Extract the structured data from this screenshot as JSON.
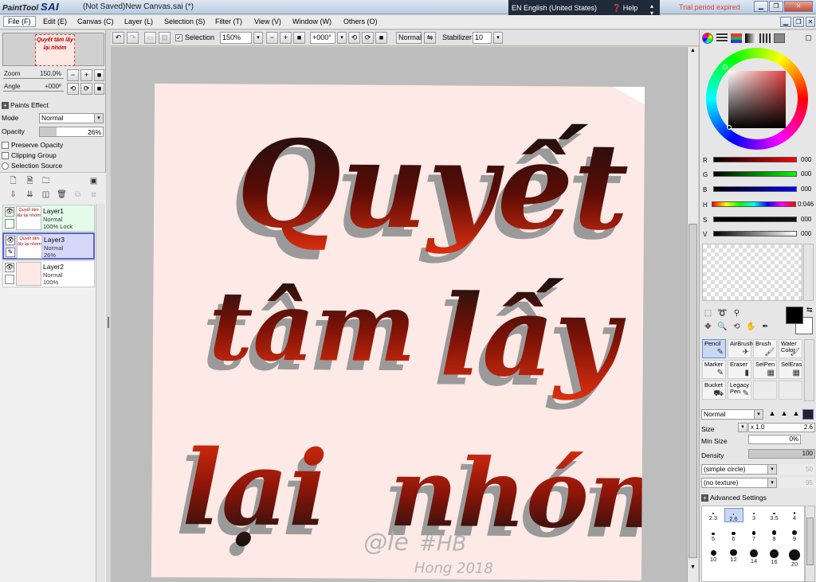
{
  "app": {
    "logo_small": "PaintTool",
    "logo_big": "SAI",
    "doc_title": "(Not Saved)New Canvas.sai (*)",
    "trial": "Trial period expired",
    "lang": "EN English (United States)",
    "help": "Help"
  },
  "menu": [
    "File (F)",
    "Edit (E)",
    "Canvas (C)",
    "Layer (L)",
    "Selection (S)",
    "Filter (T)",
    "View (V)",
    "Window (W)",
    "Others (O)"
  ],
  "toolbar": {
    "selection_label": "Selection",
    "zoom": "150%",
    "angle": "+000°",
    "blend": "Normal",
    "stabilizer_label": "Stabilizer",
    "stabilizer": "10"
  },
  "navigator": {
    "thumb_text": "Quyết tâm lấy lại nhóm",
    "zoom_label": "Zoom",
    "zoom_value": "150.0%",
    "angle_label": "Angle",
    "angle_value": "+000º"
  },
  "layer_props": {
    "paints_effect": "Paints Effect",
    "mode_label": "Mode",
    "mode_value": "Normal",
    "opacity_label": "Opacity",
    "opacity_value": "26%",
    "opacity_fraction": 0.26,
    "preserve_opacity": "Preserve Opacity",
    "clipping_group": "Clipping Group",
    "selection_source": "Selection Source"
  },
  "layers": [
    {
      "name": "Layer1",
      "mode": "Normal",
      "opacity": "100% Lock",
      "thumb": "Quyết tâm lấy lại nhóm",
      "bg": "#e4fbe9",
      "selected": false
    },
    {
      "name": "Layer3",
      "mode": "Normal",
      "opacity": "26%",
      "thumb": "Quyết tâm lấy lại nhóm",
      "bg": "#d6d8fa",
      "selected": true
    },
    {
      "name": "Layer2",
      "mode": "Normal",
      "opacity": "100%",
      "thumb": "",
      "bg": "#ffffff",
      "selected": false
    }
  ],
  "canvas": {
    "line1": "Quyết",
    "line2a": "tâm",
    "line2b": "lấy",
    "line3a": "lại",
    "line3b": "nhóm",
    "sig1": "@le",
    "sig2": "#HB",
    "sig3": "Hong 2018"
  },
  "color": {
    "labels": [
      "R",
      "G",
      "B",
      "H",
      "S",
      "V"
    ],
    "values": [
      "000",
      "000",
      "000",
      "0:046",
      "000",
      "000"
    ]
  },
  "tools": [
    {
      "label": "Pencil",
      "icon": "✎",
      "selected": true
    },
    {
      "label": "AirBrush",
      "icon": "✈",
      "selected": false
    },
    {
      "label": "Brush",
      "icon": "🖌",
      "selected": false
    },
    {
      "label": "Water Color",
      "icon": "🖌",
      "selected": false
    },
    {
      "label": "Marker",
      "icon": "✎",
      "selected": false
    },
    {
      "label": "Eraser",
      "icon": "▮",
      "selected": false
    },
    {
      "label": "SelPen",
      "icon": "▦",
      "selected": false
    },
    {
      "label": "SelEras",
      "icon": "▦",
      "selected": false
    },
    {
      "label": "Bucket",
      "icon": "⛟",
      "selected": false
    },
    {
      "label": "Legacy Pen",
      "icon": "✎",
      "selected": false
    }
  ],
  "brush": {
    "mode": "Normal",
    "size_label": "Size",
    "size_mult": "x 1.0",
    "size_value": "2.6",
    "min_size_label": "Min Size",
    "min_size_value": "0%",
    "density_label": "Density",
    "density_value": "100",
    "shape": "(simple circle)",
    "shape_val": "50",
    "texture": "(no texture)",
    "texture_val": "95",
    "advanced": "Advanced Settings"
  },
  "brush_sizes": [
    "2.3",
    "2.6",
    "3",
    "3.5",
    "4",
    "5",
    "6",
    "7",
    "8",
    "9",
    "10",
    "12",
    "14",
    "16",
    "20"
  ]
}
